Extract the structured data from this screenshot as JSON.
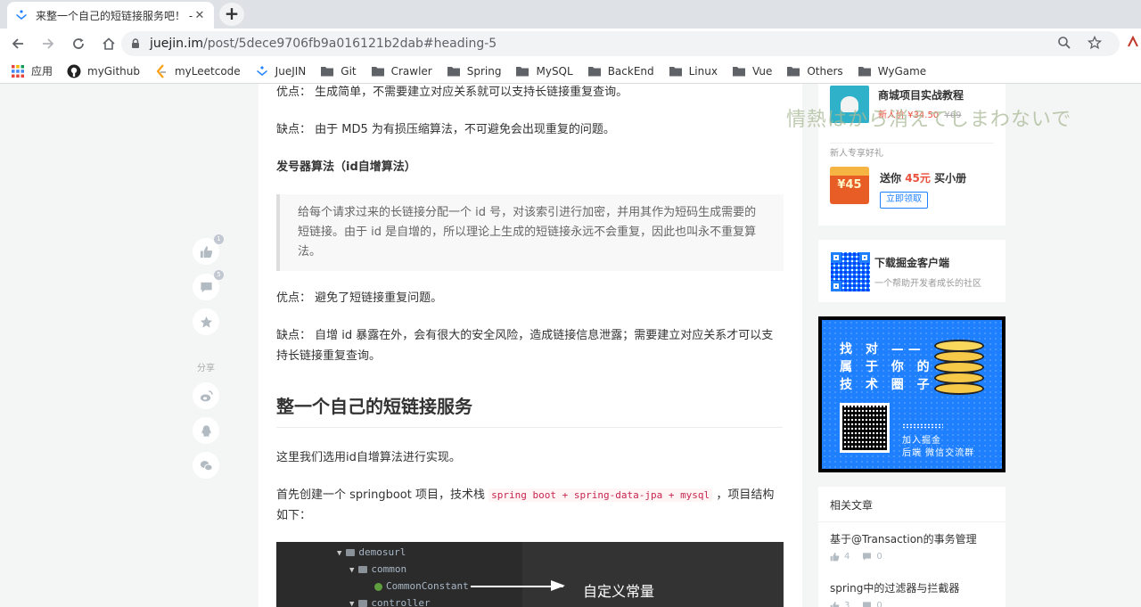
{
  "browser": {
    "tab_title": "来整一个自己的短链接服务吧！ - 掘",
    "tab_close": "✕",
    "new_tab": "+",
    "url_host": "juejin.im",
    "url_path": "/post/5dece9706fb9a016121b2dab#heading-5",
    "bookmarks": [
      {
        "label": "应用",
        "icon": "apps-icon"
      },
      {
        "label": "myGithub",
        "icon": "github-icon"
      },
      {
        "label": "myLeetcode",
        "icon": "leetcode-icon"
      },
      {
        "label": "JueJIN",
        "icon": "juejin-icon"
      },
      {
        "label": "Git",
        "icon": "folder-icon"
      },
      {
        "label": "Crawler",
        "icon": "folder-icon"
      },
      {
        "label": "Spring",
        "icon": "folder-icon"
      },
      {
        "label": "MySQL",
        "icon": "folder-icon"
      },
      {
        "label": "BackEnd",
        "icon": "folder-icon"
      },
      {
        "label": "Linux",
        "icon": "folder-icon"
      },
      {
        "label": "Vue",
        "icon": "folder-icon"
      },
      {
        "label": "Others",
        "icon": "folder-icon"
      },
      {
        "label": "WyGame",
        "icon": "folder-icon"
      }
    ]
  },
  "article": {
    "md5_pro": "优点： 生成简单，不需要建立对应关系就可以支持长链接重复查询。",
    "md5_con": "缺点： 由于 MD5 为有损压缩算法，不可避免会出现重复的问题。",
    "id_heading": "发号器算法（id自增算法）",
    "quote": "给每个请求过来的长链接分配一个 id 号，对该索引进行加密，并用其作为短码生成需要的短链接。由于 id 是自增的，所以理论上生成的短链接永远不会重复，因此也叫永不重复算法。",
    "id_pro": "优点： 避免了短链接重复问题。",
    "id_con": "缺点： 自增 id 暴露在外，会有很大的安全风险，造成链接信息泄露；需要建立对应关系才可以支持长链接重复查询。",
    "section_title": "整一个自己的短链接服务",
    "intro": "这里我们选用id自增算法进行实现。",
    "create_prefix": "首先创建一个 springboot 项目，技术栈",
    "stack_code": "spring boot + spring-data-jpa + mysql",
    "create_suffix": "，项目结构如下：",
    "code_tree": [
      "demosurl",
      "common",
      "CommonConstant",
      "controller"
    ],
    "code_annotation": "自定义常量"
  },
  "actions": {
    "like_count": "1",
    "comment_count": "5",
    "share_label": "分享"
  },
  "sidebar": {
    "course_title": "商城项目实战教程",
    "course_price_label": "新人价 ¥34.50",
    "course_old_price": "¥69",
    "newcomer_gift": "新人专享好礼",
    "coupon_value": "¥45",
    "gift_text_prefix": "送你",
    "gift_amount": "45元",
    "gift_text_suffix": "买小册",
    "claim_button": "立即领取",
    "app_title": "下载掘金客户端",
    "app_subtitle": "一个帮助开发者成长的社区",
    "promo_lines": [
      "找 对 ——",
      "属 于 你 的",
      "技 术 圈 子"
    ],
    "promo_join": "加入掘金",
    "promo_group": "后端 微信交流群",
    "related_title": "相关文章",
    "related": [
      {
        "title": "基于@Transaction的事务管理",
        "likes": "4",
        "comments": "0"
      },
      {
        "title": "spring中的过滤器与拦截器",
        "likes": "3",
        "comments": "0"
      }
    ]
  },
  "overlay": {
    "watermark": "情熱はから消えてしまわないで"
  }
}
